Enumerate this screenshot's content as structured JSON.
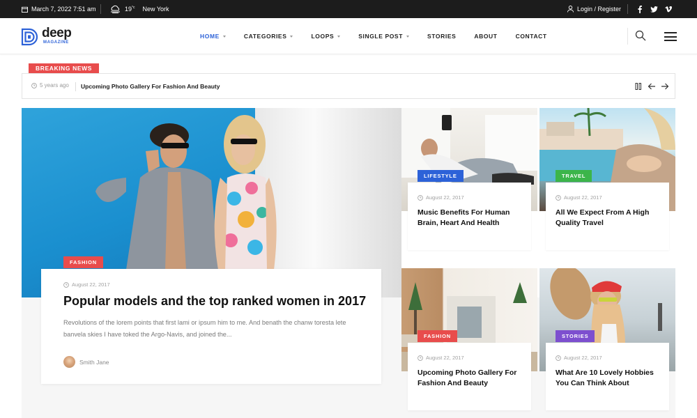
{
  "topbar": {
    "date": "March 7, 2022 7:51 am",
    "temperature": "19",
    "temperature_unit": "°c",
    "city": "New York",
    "login": "Login / Register",
    "social": [
      "facebook-icon",
      "twitter-icon",
      "vimeo-icon"
    ]
  },
  "logo": {
    "word": "deep",
    "sub": "MAGAZINE"
  },
  "nav": {
    "items": [
      {
        "label": "HOME",
        "active": true,
        "dropdown": true
      },
      {
        "label": "CATEGORIES",
        "active": false,
        "dropdown": true
      },
      {
        "label": "LOOPS",
        "active": false,
        "dropdown": true
      },
      {
        "label": "SINGLE POST",
        "active": false,
        "dropdown": true
      },
      {
        "label": "STORIES",
        "active": false,
        "dropdown": false
      },
      {
        "label": "ABOUT",
        "active": false,
        "dropdown": false
      },
      {
        "label": "CONTACT",
        "active": false,
        "dropdown": false
      }
    ]
  },
  "breaking": {
    "label": "BREAKING NEWS",
    "time": "5 years ago",
    "headline": "Upcoming Photo Gallery For Fashion And Beauty"
  },
  "featured": {
    "category": "FASHION",
    "category_color": "#e84c4c",
    "date": "August 22, 2017",
    "title": "Popular models and the top ranked women in 2017",
    "excerpt": "Revolutions of the lorem points that first lami or ipsum him to me. And benath the chanw toresta lete banvela skies I have toked the Argo-Navis, and joined the...",
    "author": "Smith Jane"
  },
  "cards": [
    {
      "category": "LIFESTYLE",
      "color": "#2d62d8",
      "date": "August 22, 2017",
      "title": "Music Benefits For Human Brain, Heart And Health"
    },
    {
      "category": "TRAVEL",
      "color": "#3cb54a",
      "date": "August 22, 2017",
      "title": "All We Expect From A High Quality Travel"
    },
    {
      "category": "FASHION",
      "color": "#e84c4c",
      "date": "August 22, 2017",
      "title": "Upcoming Photo Gallery For Fashion And Beauty"
    },
    {
      "category": "STORIES",
      "color": "#7d4fcf",
      "date": "August 22, 2017",
      "title": "What Are 10 Lovely Hobbies You Can Think About"
    }
  ],
  "colors": {
    "accent": "#2d62d8",
    "breaking": "#e84c4c",
    "topbar": "#1c1c1c"
  }
}
